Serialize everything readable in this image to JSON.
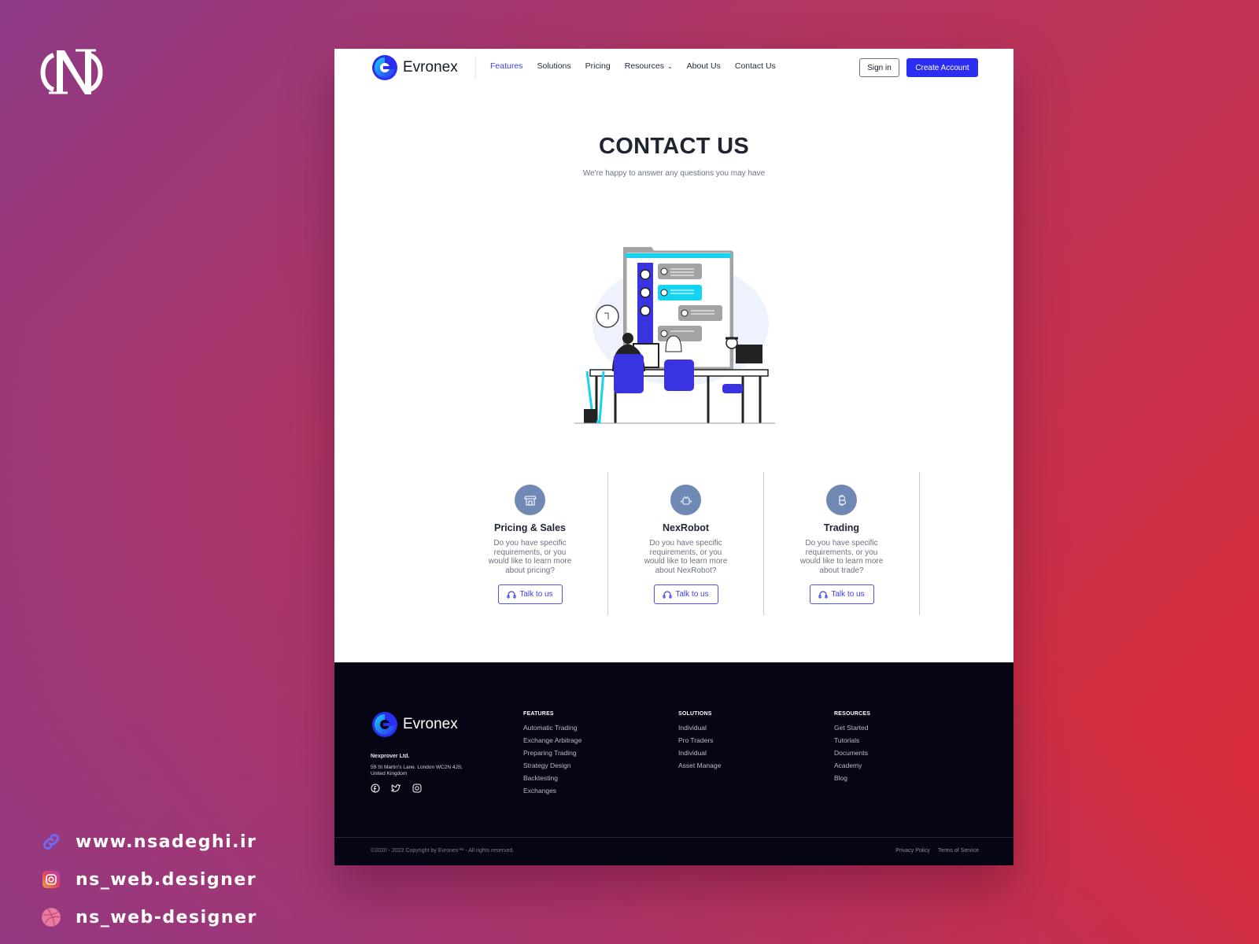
{
  "watermark": {
    "links": [
      {
        "icon": "link-icon",
        "text": "www.nsadeghi.ir"
      },
      {
        "icon": "instagram-icon",
        "text": "ns_web.designer"
      },
      {
        "icon": "dribbble-icon",
        "text": "ns_web-designer"
      }
    ]
  },
  "nav": {
    "brand": "Evronex",
    "items": [
      {
        "label": "Features",
        "active": true
      },
      {
        "label": "Solutions"
      },
      {
        "label": "Pricing"
      },
      {
        "label": "Resources",
        "dropdown": true
      },
      {
        "label": "About Us"
      },
      {
        "label": "Contact Us"
      }
    ],
    "signin": "Sign in",
    "create": "Create Account"
  },
  "hero": {
    "title": "CONTACT US",
    "subtitle": "We're happy to answer any questions you may have"
  },
  "cards": [
    {
      "icon": "store-icon",
      "title": "Pricing & Sales",
      "text": "Do you have specific requirements, or you would like to learn more about pricing?",
      "button": "Talk to us"
    },
    {
      "icon": "robot-icon",
      "title": "NexRobot",
      "text": "Do you have specific requirements, or you would like to learn more about NexRobot?",
      "button": "Talk to us"
    },
    {
      "icon": "bitcoin-icon",
      "title": "Trading",
      "text": "Do you have specific requirements, or you would like to learn more about trade?",
      "button": "Talk to us"
    }
  ],
  "footer": {
    "brand": "Evronex",
    "company": "Nexprover Ltd.",
    "address": "59 St Martin's Lane. London WC2N 4JS, United Kingdom",
    "columns": [
      {
        "title": "FEATURES",
        "links": [
          "Automatic Trading",
          "Exchange Arbitrage",
          "Preparing Trading",
          "Strategy Design",
          "Backtesting",
          "Exchanges"
        ]
      },
      {
        "title": "SOLUTIONS",
        "links": [
          "Individual",
          "Pro Traders",
          "Individual",
          "Asset Manage"
        ]
      },
      {
        "title": "RESOURCES",
        "links": [
          "Get Started",
          "Tutorials",
          "Documents",
          "Academy",
          "Blog"
        ]
      }
    ],
    "copyright": "©2020 - 2022 Copyright by Evronex™ - All rights reserved.",
    "legal": [
      "Privacy Policy",
      "Terms of Service"
    ]
  },
  "colors": {
    "accent": "#2b2ef0",
    "footer_bg": "#060514",
    "icon_circle": "#7089b4"
  }
}
